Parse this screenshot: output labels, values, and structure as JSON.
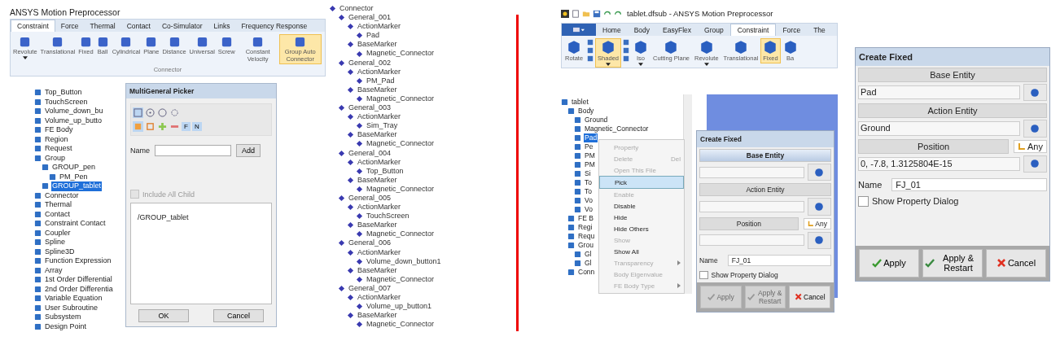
{
  "left_app": {
    "title": "ANSYS Motion Preprocessor",
    "tabs": [
      {
        "label": "Constraint",
        "selected": true
      },
      {
        "label": "Force",
        "selected": false
      },
      {
        "label": "Thermal",
        "selected": false
      },
      {
        "label": "Contact",
        "selected": false
      },
      {
        "label": "Co-Simulator",
        "selected": false
      },
      {
        "label": "Links",
        "selected": false
      },
      {
        "label": "Frequency Response",
        "selected": false
      }
    ],
    "ribbon_buttons": [
      {
        "label": "Revolute",
        "dropdown": true,
        "selected": false
      },
      {
        "label": "Translational",
        "dropdown": false,
        "selected": false
      },
      {
        "label": "Fixed",
        "dropdown": false,
        "selected": false
      },
      {
        "label": "Ball",
        "dropdown": false,
        "selected": false
      },
      {
        "label": "Cylindrical",
        "dropdown": false,
        "selected": false
      },
      {
        "label": "Plane",
        "dropdown": false,
        "selected": false
      },
      {
        "label": "Distance",
        "dropdown": false,
        "selected": false
      },
      {
        "label": "Universal",
        "dropdown": false,
        "selected": false
      },
      {
        "label": "Screw",
        "dropdown": false,
        "selected": false
      },
      {
        "label": "Constant Velocity",
        "dropdown": false,
        "selected": false
      },
      {
        "label": "Group Auto Connector",
        "dropdown": false,
        "selected": true
      }
    ],
    "ribbon_group": "Connector"
  },
  "left_tree": {
    "items": [
      {
        "label": "Top_Button",
        "selected": false
      },
      {
        "label": "TouchScreen",
        "selected": false
      },
      {
        "label": "Volume_down_bu",
        "selected": false
      },
      {
        "label": "Volume_up_butto",
        "selected": false
      },
      {
        "label": "FE Body",
        "selected": false
      },
      {
        "label": "Region",
        "selected": false
      },
      {
        "label": "Request",
        "selected": false
      },
      {
        "label": "Group",
        "selected": false,
        "children": [
          {
            "label": "GROUP_pen",
            "selected": false,
            "children": [
              {
                "label": "PM_Pen",
                "selected": false
              }
            ]
          },
          {
            "label": "GROUP_tablet",
            "selected": true
          }
        ]
      },
      {
        "label": "Connector",
        "selected": false
      },
      {
        "label": "Thermal",
        "selected": false
      },
      {
        "label": "Contact",
        "selected": false
      },
      {
        "label": "Constraint Contact",
        "selected": false
      },
      {
        "label": "Coupler",
        "selected": false
      },
      {
        "label": "Spline",
        "selected": false
      },
      {
        "label": "Spline3D",
        "selected": false
      },
      {
        "label": "Function Expression",
        "selected": false
      },
      {
        "label": "Array",
        "selected": false
      },
      {
        "label": "1st Order Differential",
        "selected": false
      },
      {
        "label": "2nd Order Differentia",
        "selected": false
      },
      {
        "label": "Variable Equation",
        "selected": false
      },
      {
        "label": "User Subroutine",
        "selected": false
      },
      {
        "label": "Subsystem",
        "selected": false
      },
      {
        "label": "Design Point",
        "selected": false
      }
    ]
  },
  "picker": {
    "title": "MultiGeneral Picker",
    "mode_buttons": [
      "F",
      "N"
    ],
    "name_label": "Name",
    "add_button": "Add",
    "include_all_child": {
      "label": "Include All Child",
      "checked": false,
      "disabled": true
    },
    "list_items": [
      "/GROUP_tablet"
    ],
    "buttons": [
      "OK",
      "Cancel"
    ]
  },
  "connector_tree": {
    "items": [
      {
        "label": "Connector",
        "selected": false,
        "children": [
          {
            "label": "General_001",
            "selected": false,
            "children": [
              {
                "label": "ActionMarker",
                "selected": false,
                "children": [
                  {
                    "label": "Pad",
                    "selected": false
                  }
                ]
              },
              {
                "label": "BaseMarker",
                "selected": false,
                "children": [
                  {
                    "label": "Magnetic_Connector",
                    "selected": false
                  }
                ]
              }
            ]
          },
          {
            "label": "General_002",
            "selected": false,
            "children": [
              {
                "label": "ActionMarker",
                "selected": false,
                "children": [
                  {
                    "label": "PM_Pad",
                    "selected": false
                  }
                ]
              },
              {
                "label": "BaseMarker",
                "selected": false,
                "children": [
                  {
                    "label": "Magnetic_Connector",
                    "selected": false
                  }
                ]
              }
            ]
          },
          {
            "label": "General_003",
            "selected": false,
            "children": [
              {
                "label": "ActionMarker",
                "selected": false,
                "children": [
                  {
                    "label": "Sim_Tray",
                    "selected": false
                  }
                ]
              },
              {
                "label": "BaseMarker",
                "selected": false,
                "children": [
                  {
                    "label": "Magnetic_Connector",
                    "selected": false
                  }
                ]
              }
            ]
          },
          {
            "label": "General_004",
            "selected": false,
            "children": [
              {
                "label": "ActionMarker",
                "selected": false,
                "children": [
                  {
                    "label": "Top_Button",
                    "selected": false
                  }
                ]
              },
              {
                "label": "BaseMarker",
                "selected": false,
                "children": [
                  {
                    "label": "Magnetic_Connector",
                    "selected": false
                  }
                ]
              }
            ]
          },
          {
            "label": "General_005",
            "selected": false,
            "children": [
              {
                "label": "ActionMarker",
                "selected": false,
                "children": [
                  {
                    "label": "TouchScreen",
                    "selected": false
                  }
                ]
              },
              {
                "label": "BaseMarker",
                "selected": false,
                "children": [
                  {
                    "label": "Magnetic_Connector",
                    "selected": false
                  }
                ]
              }
            ]
          },
          {
            "label": "General_006",
            "selected": false,
            "children": [
              {
                "label": "ActionMarker",
                "selected": false,
                "children": [
                  {
                    "label": "Volume_down_button1",
                    "selected": false
                  }
                ]
              },
              {
                "label": "BaseMarker",
                "selected": false,
                "children": [
                  {
                    "label": "Magnetic_Connector",
                    "selected": false
                  }
                ]
              }
            ]
          },
          {
            "label": "General_007",
            "selected": false,
            "children": [
              {
                "label": "ActionMarker",
                "selected": false,
                "children": [
                  {
                    "label": "Volume_up_button1",
                    "selected": false
                  }
                ]
              },
              {
                "label": "BaseMarker",
                "selected": false,
                "children": [
                  {
                    "label": "Magnetic_Connector",
                    "selected": false
                  }
                ]
              }
            ]
          }
        ]
      }
    ]
  },
  "right_app": {
    "title": "tablet.dfsub - ANSYS Motion Preprocessor",
    "tabs": [
      {
        "label": "Home",
        "selected": false
      },
      {
        "label": "Body",
        "selected": false
      },
      {
        "label": "EasyFlex",
        "selected": false
      },
      {
        "label": "Group",
        "selected": false
      },
      {
        "label": "Constraint",
        "selected": true
      },
      {
        "label": "Force",
        "selected": false
      },
      {
        "label": "The",
        "selected": false
      }
    ],
    "ribbon_buttons": [
      {
        "label": "Rotate",
        "dropdown": false,
        "selected": false
      },
      {
        "label": "Shaded",
        "dropdown": true,
        "selected": true
      },
      {
        "label": "Iso",
        "dropdown": true,
        "selected": false
      },
      {
        "label": "Cutting Plane",
        "dropdown": false,
        "selected": false
      },
      {
        "label": "Revolute",
        "dropdown": true,
        "selected": false
      },
      {
        "label": "Translational",
        "dropdown": false,
        "selected": false
      },
      {
        "label": "Fixed",
        "dropdown": false,
        "selected": true
      },
      {
        "label": "Ba",
        "dropdown": false,
        "selected": false
      }
    ]
  },
  "model_tree": {
    "items": [
      {
        "label": "tablet",
        "selected": false,
        "children": [
          {
            "label": "Body",
            "selected": false,
            "children": [
              {
                "label": "Ground",
                "selected": false
              },
              {
                "label": "Magnetic_Connector",
                "selected": false
              },
              {
                "label": "Pad",
                "selected": true
              },
              {
                "label": "Pe",
                "selected": false
              },
              {
                "label": "PM",
                "selected": false
              },
              {
                "label": "PM",
                "selected": false
              },
              {
                "label": "Si",
                "selected": false
              },
              {
                "label": "To",
                "selected": false
              },
              {
                "label": "To",
                "selected": false
              },
              {
                "label": "Vo",
                "selected": false
              },
              {
                "label": "Vo",
                "selected": false
              }
            ]
          },
          {
            "label": "FE B",
            "selected": false
          },
          {
            "label": "Regi",
            "selected": false
          },
          {
            "label": "Requ",
            "selected": false
          },
          {
            "label": "Grou",
            "selected": false,
            "children": [
              {
                "label": "Gl",
                "selected": false
              },
              {
                "label": "Gl",
                "selected": false
              }
            ]
          },
          {
            "label": "Conn",
            "selected": false
          }
        ]
      }
    ]
  },
  "context_menu": {
    "items": [
      {
        "label": "Property",
        "disabled": true,
        "selected": false
      },
      {
        "label": "Delete",
        "shortcut": "Del",
        "disabled": true,
        "selected": false
      },
      {
        "label": "Open This File",
        "disabled": true,
        "selected": false
      },
      {
        "label": "Pick",
        "disabled": false,
        "selected": true
      },
      {
        "label": "Enable",
        "disabled": true,
        "selected": false
      },
      {
        "label": "Disable",
        "disabled": false,
        "selected": false
      },
      {
        "label": "Hide",
        "disabled": false,
        "selected": false
      },
      {
        "label": "Hide Others",
        "disabled": false,
        "selected": false
      },
      {
        "label": "Show",
        "disabled": true,
        "selected": false
      },
      {
        "label": "Show All",
        "disabled": false,
        "selected": false
      },
      {
        "label": "Transparency",
        "submenu": true,
        "disabled": true,
        "selected": false
      },
      {
        "label": "Body Eigenvalue",
        "disabled": true,
        "selected": false
      },
      {
        "label": "FE Body Type",
        "submenu": true,
        "disabled": true,
        "selected": false
      }
    ]
  },
  "create_fixed_small": {
    "title": "Create Fixed",
    "base_entity_label": "Base Entity",
    "base_entity_active": true,
    "action_entity_label": "Action Entity",
    "position_label": "Position",
    "position_mode": "Any",
    "name_label": "Name",
    "name_value": "FJ_01",
    "show_property": {
      "label": "Show Property Dialog",
      "checked": false
    },
    "buttons": [
      {
        "label": "Apply",
        "kind": "apply",
        "disabled": true
      },
      {
        "label": "Apply & Restart",
        "kind": "apply-restart",
        "disabled": true
      },
      {
        "label": "Cancel",
        "kind": "cancel",
        "disabled": false
      }
    ]
  },
  "create_fixed_large": {
    "title": "Create Fixed",
    "base_entity_label": "Base Entity",
    "base_entity_active": false,
    "base_entity_value": "Pad",
    "action_entity_label": "Action Entity",
    "action_entity_value": "Ground",
    "position_label": "Position",
    "position_mode": "Any",
    "position_value": "0, -7.8, 1.3125804E-15",
    "name_label": "Name",
    "name_value": "FJ_01",
    "show_property": {
      "label": "Show Property Dialog",
      "checked": false
    },
    "buttons": [
      {
        "label": "Apply",
        "kind": "apply",
        "disabled": false
      },
      {
        "label": "Apply & Restart",
        "kind": "apply-restart",
        "disabled": false
      },
      {
        "label": "Cancel",
        "kind": "cancel",
        "disabled": false
      }
    ]
  }
}
